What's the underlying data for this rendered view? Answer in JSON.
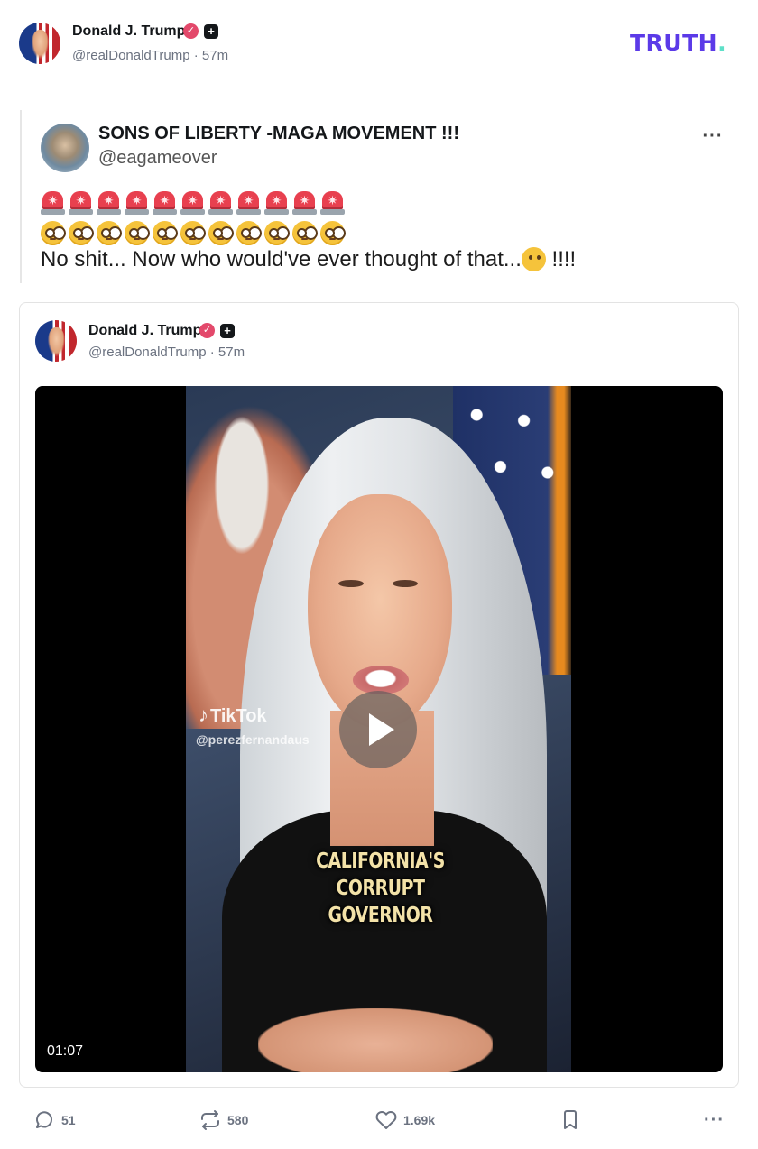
{
  "header": {
    "author_name": "Donald J. Trump",
    "verified_badge": "✓",
    "plus_badge": "+",
    "handle": "@realDonaldTrump",
    "time": "57m",
    "logo_text": "TRUTH",
    "logo_dot": ".",
    "logo_color": "#5b3ae8",
    "logo_dot_color": "#5ee0c8"
  },
  "quote": {
    "author_name": "SONS OF LIBERTY -MAGA MOVEMENT !!!",
    "handle": "@eagameover",
    "more_icon": "more-horizontal-icon",
    "more_label": "···",
    "emoji_row_1": {
      "icon": "police-light-icon",
      "count": 11
    },
    "emoji_row_2": {
      "icon": "flushed-face-icon",
      "count": 11
    },
    "text_before": "No shit... Now who would've ever thought of that...",
    "thinking_emoji": "thinking-face-icon",
    "text_after": " !!!!"
  },
  "card": {
    "author_name": "Donald J. Trump",
    "verified_badge": "✓",
    "plus_badge": "+",
    "handle": "@realDonaldTrump",
    "time": "57m",
    "video": {
      "watermark_brand": "TikTok",
      "watermark_icon": "♪",
      "watermark_handle": "@perezfernandaus",
      "caption": "CALIFORNIA'S CORRUPT GOVERNOR",
      "duration": "01:07",
      "play_icon": "play-icon"
    }
  },
  "actions": {
    "replies": "51",
    "retruths": "580",
    "likes": "1.69k",
    "reply_icon": "reply-icon",
    "retruth_icon": "retruth-icon",
    "like_icon": "heart-icon",
    "bookmark_icon": "bookmark-icon",
    "more_icon": "more-horizontal-icon",
    "more_label": "···"
  },
  "colors": {
    "verified": "#e3496b",
    "text_muted": "#6b7280"
  }
}
